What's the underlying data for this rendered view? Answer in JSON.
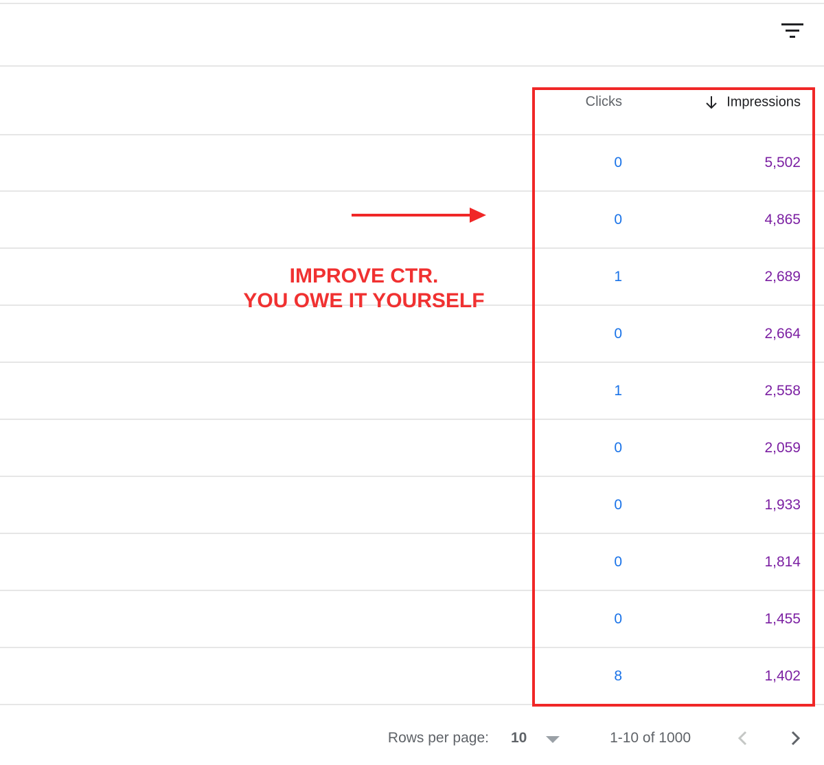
{
  "toolbar": {
    "filter_icon": "filter-list-icon"
  },
  "table": {
    "columns": {
      "clicks": "Clicks",
      "impressions": "Impressions",
      "sort_icon": "arrow-downward-icon"
    },
    "rows": [
      {
        "clicks": "0",
        "impressions": "5,502"
      },
      {
        "clicks": "0",
        "impressions": "4,865"
      },
      {
        "clicks": "1",
        "impressions": "2,689"
      },
      {
        "clicks": "0",
        "impressions": "2,664"
      },
      {
        "clicks": "1",
        "impressions": "2,558"
      },
      {
        "clicks": "0",
        "impressions": "2,059"
      },
      {
        "clicks": "0",
        "impressions": "1,933"
      },
      {
        "clicks": "0",
        "impressions": "1,814"
      },
      {
        "clicks": "0",
        "impressions": "1,455"
      },
      {
        "clicks": "8",
        "impressions": "1,402"
      }
    ]
  },
  "annotation": {
    "line1": "IMPROVE CTR.",
    "line2": "YOU OWE IT YOURSELF",
    "color": "#f02727"
  },
  "pagination": {
    "rows_per_page_label": "Rows per page:",
    "rows_per_page_value": "10",
    "range_text": "1-10 of 1000",
    "prev_icon": "chevron-left-icon",
    "next_icon": "chevron-right-icon"
  },
  "colors": {
    "clicks": "#1a73e8",
    "impressions": "#7b1fa2",
    "divider": "#e6e6e6"
  }
}
